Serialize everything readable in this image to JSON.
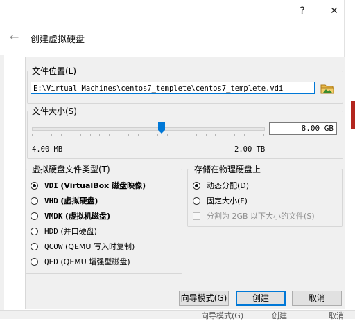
{
  "window": {
    "help_glyph": "?",
    "close_glyph": "✕"
  },
  "header": {
    "back_glyph": "←",
    "title": "创建虚拟硬盘"
  },
  "location": {
    "label": "文件位置(L)",
    "path": "E:\\Virtual Machines\\centos7_templete\\centos7_templete.vdi"
  },
  "size": {
    "label": "文件大小(S)",
    "value": "8.00 GB",
    "min_label": "4.00 MB",
    "max_label": "2.00 TB",
    "slider_fraction": 0.56
  },
  "disk_type": {
    "label": "虚拟硬盘文件类型(T)",
    "options": [
      {
        "code": "VDI",
        "desc": "(VirtualBox 磁盘映像)",
        "selected": true
      },
      {
        "code": "VHD",
        "desc": "(虚拟硬盘)",
        "selected": false
      },
      {
        "code": "VMDK",
        "desc": "(虚拟机磁盘)",
        "selected": false
      },
      {
        "code": "HDD",
        "desc": "(并口硬盘)",
        "selected": false
      },
      {
        "code": "QCOW",
        "desc": "(QEMU 写入时复制)",
        "selected": false
      },
      {
        "code": "QED",
        "desc": "(QEMU 增强型磁盘)",
        "selected": false
      }
    ]
  },
  "storage": {
    "label": "存储在物理硬盘上",
    "dynamic": "动态分配(D)",
    "fixed": "固定大小(F)",
    "split": "分割为 2GB 以下大小的文件(S)"
  },
  "buttons": {
    "guided": "向导模式(G)",
    "create": "创建",
    "cancel": "取消"
  },
  "background": {
    "behind_left": "向导模式(G)",
    "behind_mid": "创建",
    "behind_right": "取消"
  }
}
